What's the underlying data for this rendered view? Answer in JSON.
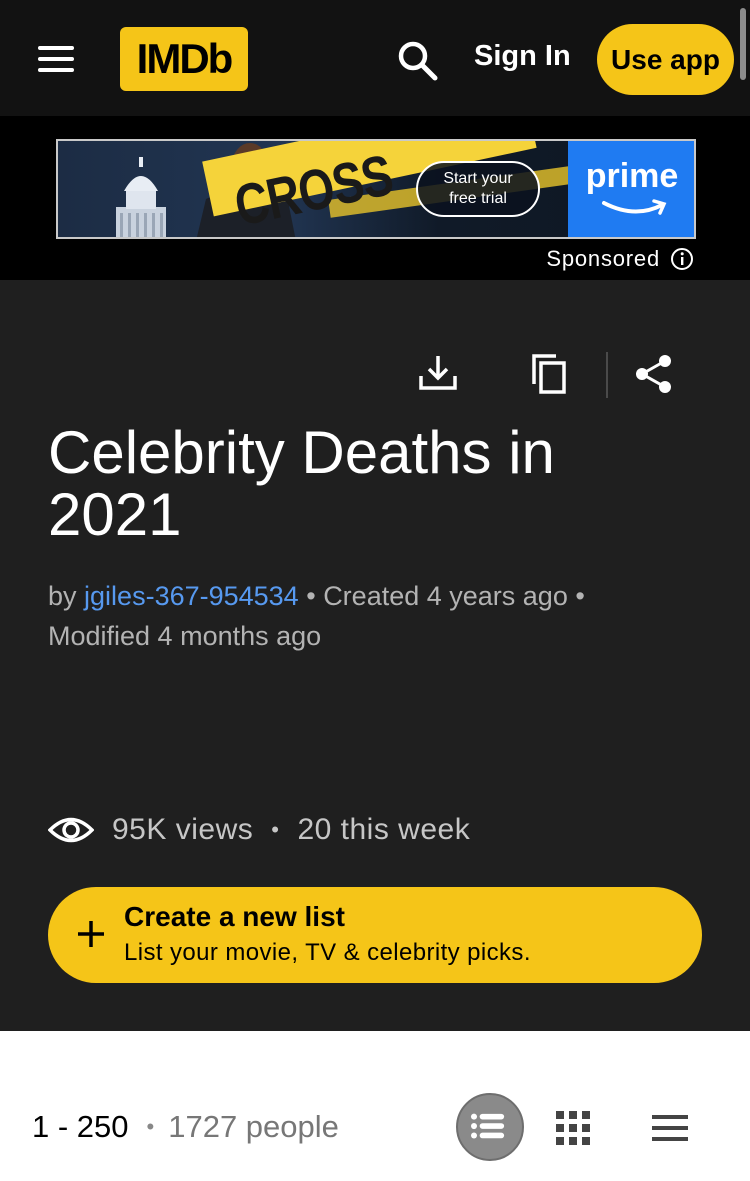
{
  "header": {
    "logo_text": "IMDb",
    "sign_in_label": "Sign In",
    "use_app_label": "Use app",
    "brand_color": "#f5c518"
  },
  "ad": {
    "banner_title": "CROSS",
    "cta_line1": "Start your",
    "cta_line2": "free trial",
    "brand_word": "prime",
    "sponsored_label": "Sponsored"
  },
  "list": {
    "title": "Celebrity Deaths in 2021",
    "by_prefix": "by",
    "author": "jgiles-367-954534",
    "created": "Created 4 years ago",
    "modified": "Modified 4 months ago",
    "views": "95K views",
    "views_week": "20 this week"
  },
  "create_list": {
    "title": "Create a new list",
    "subtitle": "List your movie, TV & celebrity picks."
  },
  "results": {
    "range": "1 - 250",
    "people": "1727 people"
  },
  "icons": {
    "menu": "menu-icon",
    "search": "search-icon",
    "info": "info-icon",
    "download": "download-icon",
    "copy": "copy-icon",
    "share": "share-icon",
    "eye": "eye-icon",
    "plus": "plus-icon",
    "detailed_view": "detailed-view-icon",
    "grid_view": "grid-view-icon",
    "compact_view": "compact-view-icon"
  }
}
